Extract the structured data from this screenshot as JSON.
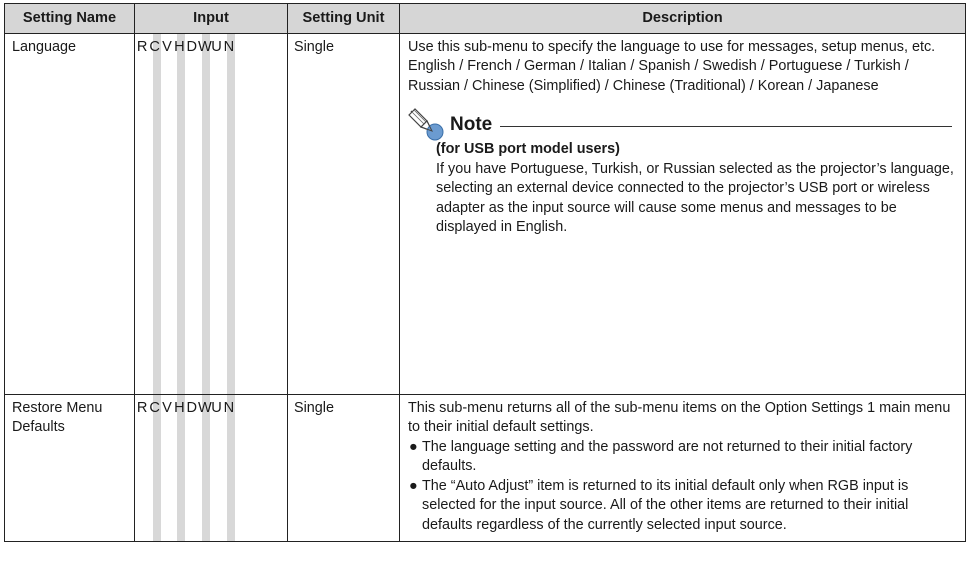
{
  "table": {
    "headers": {
      "name": "Setting Name",
      "input": "Input",
      "unit": "Setting Unit",
      "description": "Description"
    },
    "rows": [
      {
        "name": "Language",
        "inputs": [
          "R",
          "C",
          "V",
          "H",
          "D",
          "W",
          "U",
          "N"
        ],
        "unit": "Single",
        "desc_paragraphs": [
          "Use this sub-menu to specify the language to use for messages, setup menus, etc.",
          "English / French / German / Italian / Spanish / Swedish / Portuguese / Turkish / Russian / Chinese (Simplified) / Chinese (Traditional) / Korean / Japanese"
        ],
        "note": {
          "title": "Note",
          "subtitle": "(for USB port model users)",
          "body": "If you have Portuguese, Turkish, or Russian selected as the projector’s language, selecting an external device connected to the projector’s USB port or wireless adapter as the input source will cause some menus and messages to be displayed in English."
        }
      },
      {
        "name": "Restore Menu Defaults",
        "inputs": [
          "R",
          "C",
          "V",
          "H",
          "D",
          "W",
          "U",
          "N"
        ],
        "unit": "Single",
        "desc_paragraphs": [
          "This sub-menu returns all of the sub-menu items on the Option Settings 1 main menu to their initial default settings."
        ],
        "bullet_symbol": "●",
        "bullets": [
          "The language setting and the password are not returned to their initial factory defaults.",
          "The “Auto Adjust” item is returned to its initial default only when RGB input is selected for the input source. All of the other items are returned to their initial defaults regardless of the currently selected input source."
        ]
      }
    ]
  },
  "icons": {
    "note": "pencil-note-icon"
  }
}
